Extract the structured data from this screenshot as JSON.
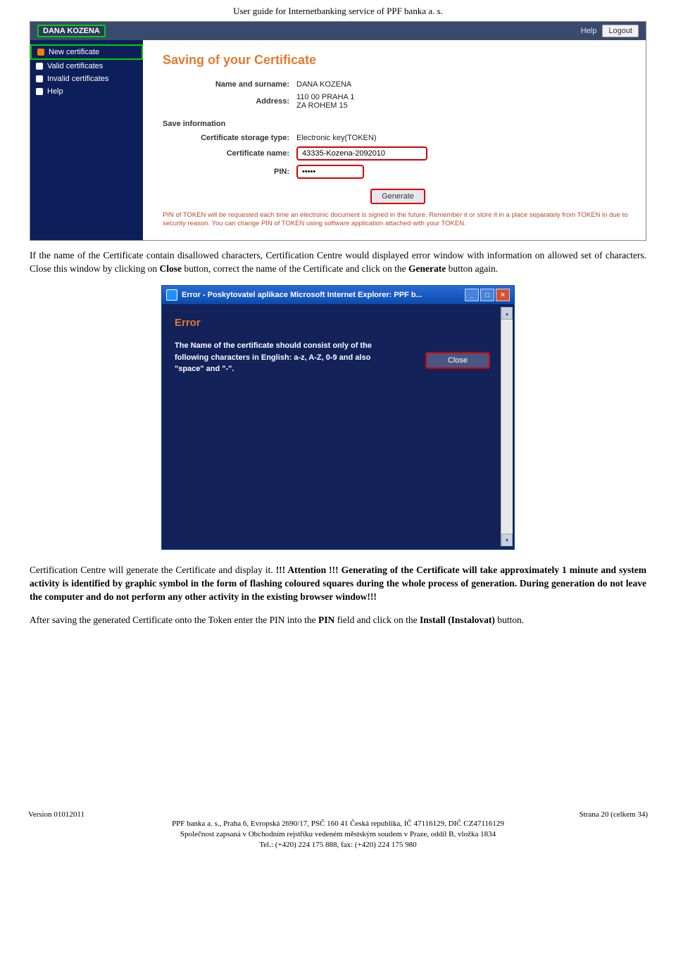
{
  "header": "User guide for Internetbanking service of PPF banka a. s.",
  "shot1": {
    "user": "DANA KOZENA",
    "help": "Help",
    "logout": "Logout",
    "sidebar": [
      {
        "label": "New certificate",
        "hl": true,
        "orange": true
      },
      {
        "label": "Valid certificates"
      },
      {
        "label": "Invalid certificates"
      },
      {
        "label": "Help"
      }
    ],
    "title": "Saving of your Certificate",
    "name_label": "Name and surname:",
    "name_value": "DANA KOZENA",
    "address_label": "Address:",
    "address_value1": "110 00 PRAHA 1",
    "address_value2": "ZA ROHEM 15",
    "section": "Save information",
    "storage_label": "Certificate storage type:",
    "storage_value": "Electronic key(TOKEN)",
    "certname_label": "Certificate name:",
    "certname_value": "43335-Kozena-2092010",
    "pin_label": "PIN:",
    "pin_value": "•••••",
    "generate": "Generate",
    "warn": "PIN of TOKEN will be requested each time an electronic document is signed in the future. Remember it or store it in a place separately from TOKEN in due to security reason. You can change PIN of TOKEN using software application attached with your TOKEN."
  },
  "para1_a": "If the name of the Certificate contain disallowed characters, Certification Centre would displayed error window with information on allowed set of characters. Close this window by clicking on ",
  "para1_b": "Close",
  "para1_c": " button, correct the name of the Certificate and click on the ",
  "para1_d": "Generate",
  "para1_e": " button again.",
  "shot2": {
    "title": "Error - Poskytovatel aplikace Microsoft Internet Explorer: PPF b...",
    "err_head": "Error",
    "err_text": "The Name of the certificate should consist only of the following characters in English: a-z, A-Z, 0-9 and also \"space\" and \"-\".",
    "close": "Close"
  },
  "para2_a": "Certification Centre will generate the Certificate and display it.",
  "para2_b": "!!! Attention !!! Generating of the Certificate will take approximately 1 minute and system activity is identified by graphic symbol in the form of flashing coloured squares during the whole process of generation. During generation do not leave the computer and do not perform any other activity in the existing browser window!!!",
  "para3_a": "After saving the generated Certificate onto the Token enter the PIN into the ",
  "para3_b": "PIN",
  "para3_c": " field and click on the ",
  "para3_d": "Install (Instalovat)",
  "para3_e": " button.",
  "footer": {
    "version": "Version 01012011",
    "page": "Strana 20 (celkem 34)",
    "l1": "PPF banka a. s., Praha 6, Evropská 2690/17, PSČ 160 41 Česká republika, IČ 47116129, DIČ CZ47116129",
    "l2": "Společnost zapsaná v Obchodním rejstříku vedeném městským soudem v Praze, oddíl B, vložka 1834",
    "l3": "Tel.: (+420) 224 175 888, fax: (+420) 224 175 980"
  }
}
